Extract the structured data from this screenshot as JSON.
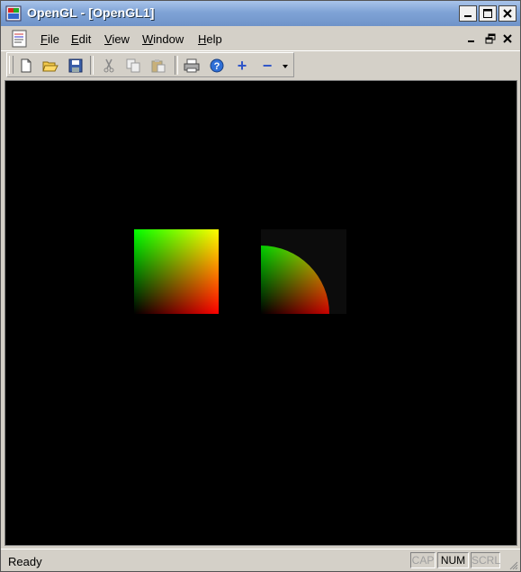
{
  "window": {
    "title": "OpenGL - [OpenGL1]",
    "controls": {
      "minimize": "minimize-icon",
      "maximize": "maximize-icon",
      "close": "close-icon"
    }
  },
  "menu": {
    "items": [
      {
        "label": "File",
        "accel": "F"
      },
      {
        "label": "Edit",
        "accel": "E"
      },
      {
        "label": "View",
        "accel": "V"
      },
      {
        "label": "Window",
        "accel": "W"
      },
      {
        "label": "Help",
        "accel": "H"
      }
    ]
  },
  "toolbar": {
    "buttons": [
      "new-icon",
      "open-icon",
      "save-icon",
      "cut-icon",
      "copy-icon",
      "paste-icon",
      "print-icon",
      "help-icon",
      "zoom-in-icon",
      "zoom-out-icon",
      "overflow-icon"
    ],
    "zoom_in": "+",
    "zoom_out": "−"
  },
  "viewport": {
    "background": "#000000",
    "shapes": [
      {
        "kind": "gradient-square",
        "corners": {
          "top-left": "#00ff00",
          "top-right": "#ffff00",
          "bottom-left": "#000000",
          "bottom-right": "#ff0000"
        }
      },
      {
        "kind": "gradient-quarter-disc",
        "corners": {
          "top-left": "#00ff00",
          "bottom-left": "#000000",
          "bottom-right": "#ff0000"
        },
        "backdrop": "#0c0c0c"
      }
    ]
  },
  "status": {
    "text": "Ready",
    "indicators": [
      {
        "label": "CAP",
        "active": false
      },
      {
        "label": "NUM",
        "active": true
      },
      {
        "label": "SCRL",
        "active": false
      }
    ]
  }
}
